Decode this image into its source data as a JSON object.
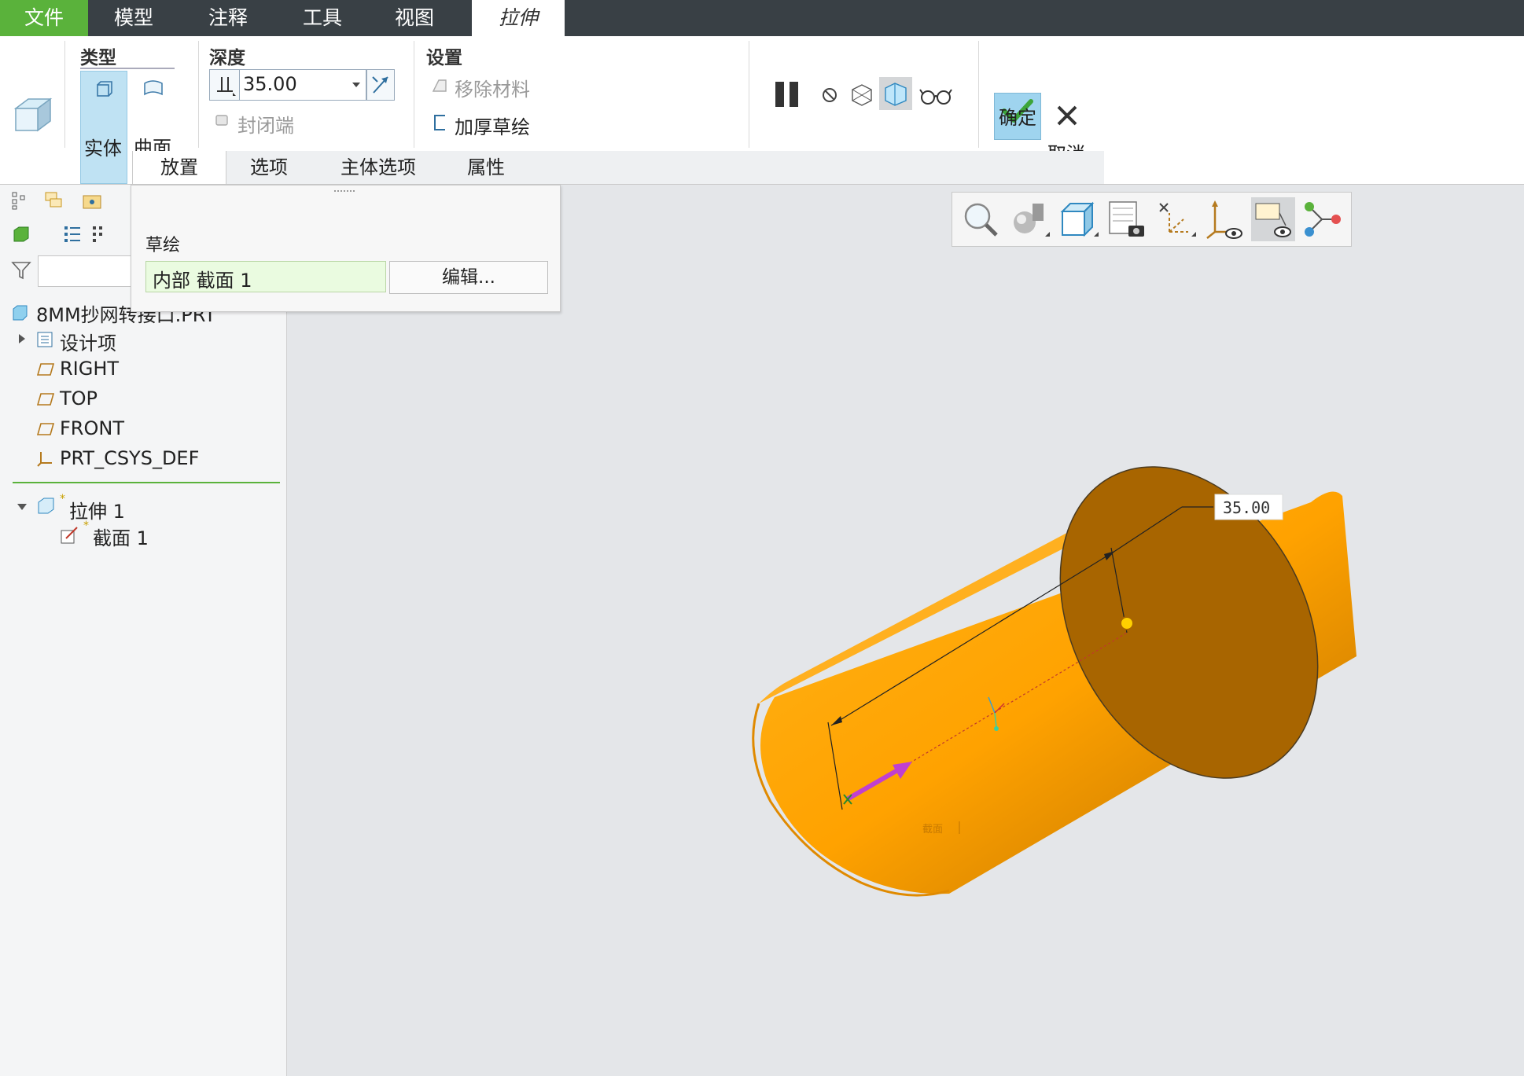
{
  "menu": {
    "tabs": [
      {
        "label": "文件"
      },
      {
        "label": "模型"
      },
      {
        "label": "注释"
      },
      {
        "label": "工具"
      },
      {
        "label": "视图"
      },
      {
        "label": "拉伸"
      }
    ]
  },
  "ribbon": {
    "type_group": {
      "title": "类型",
      "solid_label": "实体",
      "surface_label": "曲面"
    },
    "depth_group": {
      "title": "深度",
      "value": "35.00",
      "cap_label": "封闭端"
    },
    "settings_group": {
      "title": "设置",
      "remove_material_label": "移除材料",
      "thicken_label": "加厚草绘"
    },
    "confirm_label": "确定",
    "cancel_label": "取消",
    "sub_tabs": [
      {
        "label": "放置"
      },
      {
        "label": "选项"
      },
      {
        "label": "主体选项"
      },
      {
        "label": "属性"
      }
    ]
  },
  "placement_panel": {
    "sketch_label": "草绘",
    "section_value": "内部 截面 1",
    "edit_button": "编辑..."
  },
  "tree": {
    "root": "8MM抄网转接口.PRT",
    "items": [
      {
        "label": "设计项"
      },
      {
        "label": "RIGHT"
      },
      {
        "label": "TOP"
      },
      {
        "label": "FRONT"
      },
      {
        "label": "PRT_CSYS_DEF"
      }
    ],
    "feature": {
      "label": "拉伸 1",
      "child": "截面 1"
    }
  },
  "viewport": {
    "dimension_value": "35.00",
    "section_tag": "截面",
    "model_color": "#ffa500"
  },
  "colors": {
    "menubar": "#394045",
    "file_tab": "#5ab23b",
    "accent_blue": "#9fd4ef",
    "viewport_bg": "#e4e6e9"
  }
}
